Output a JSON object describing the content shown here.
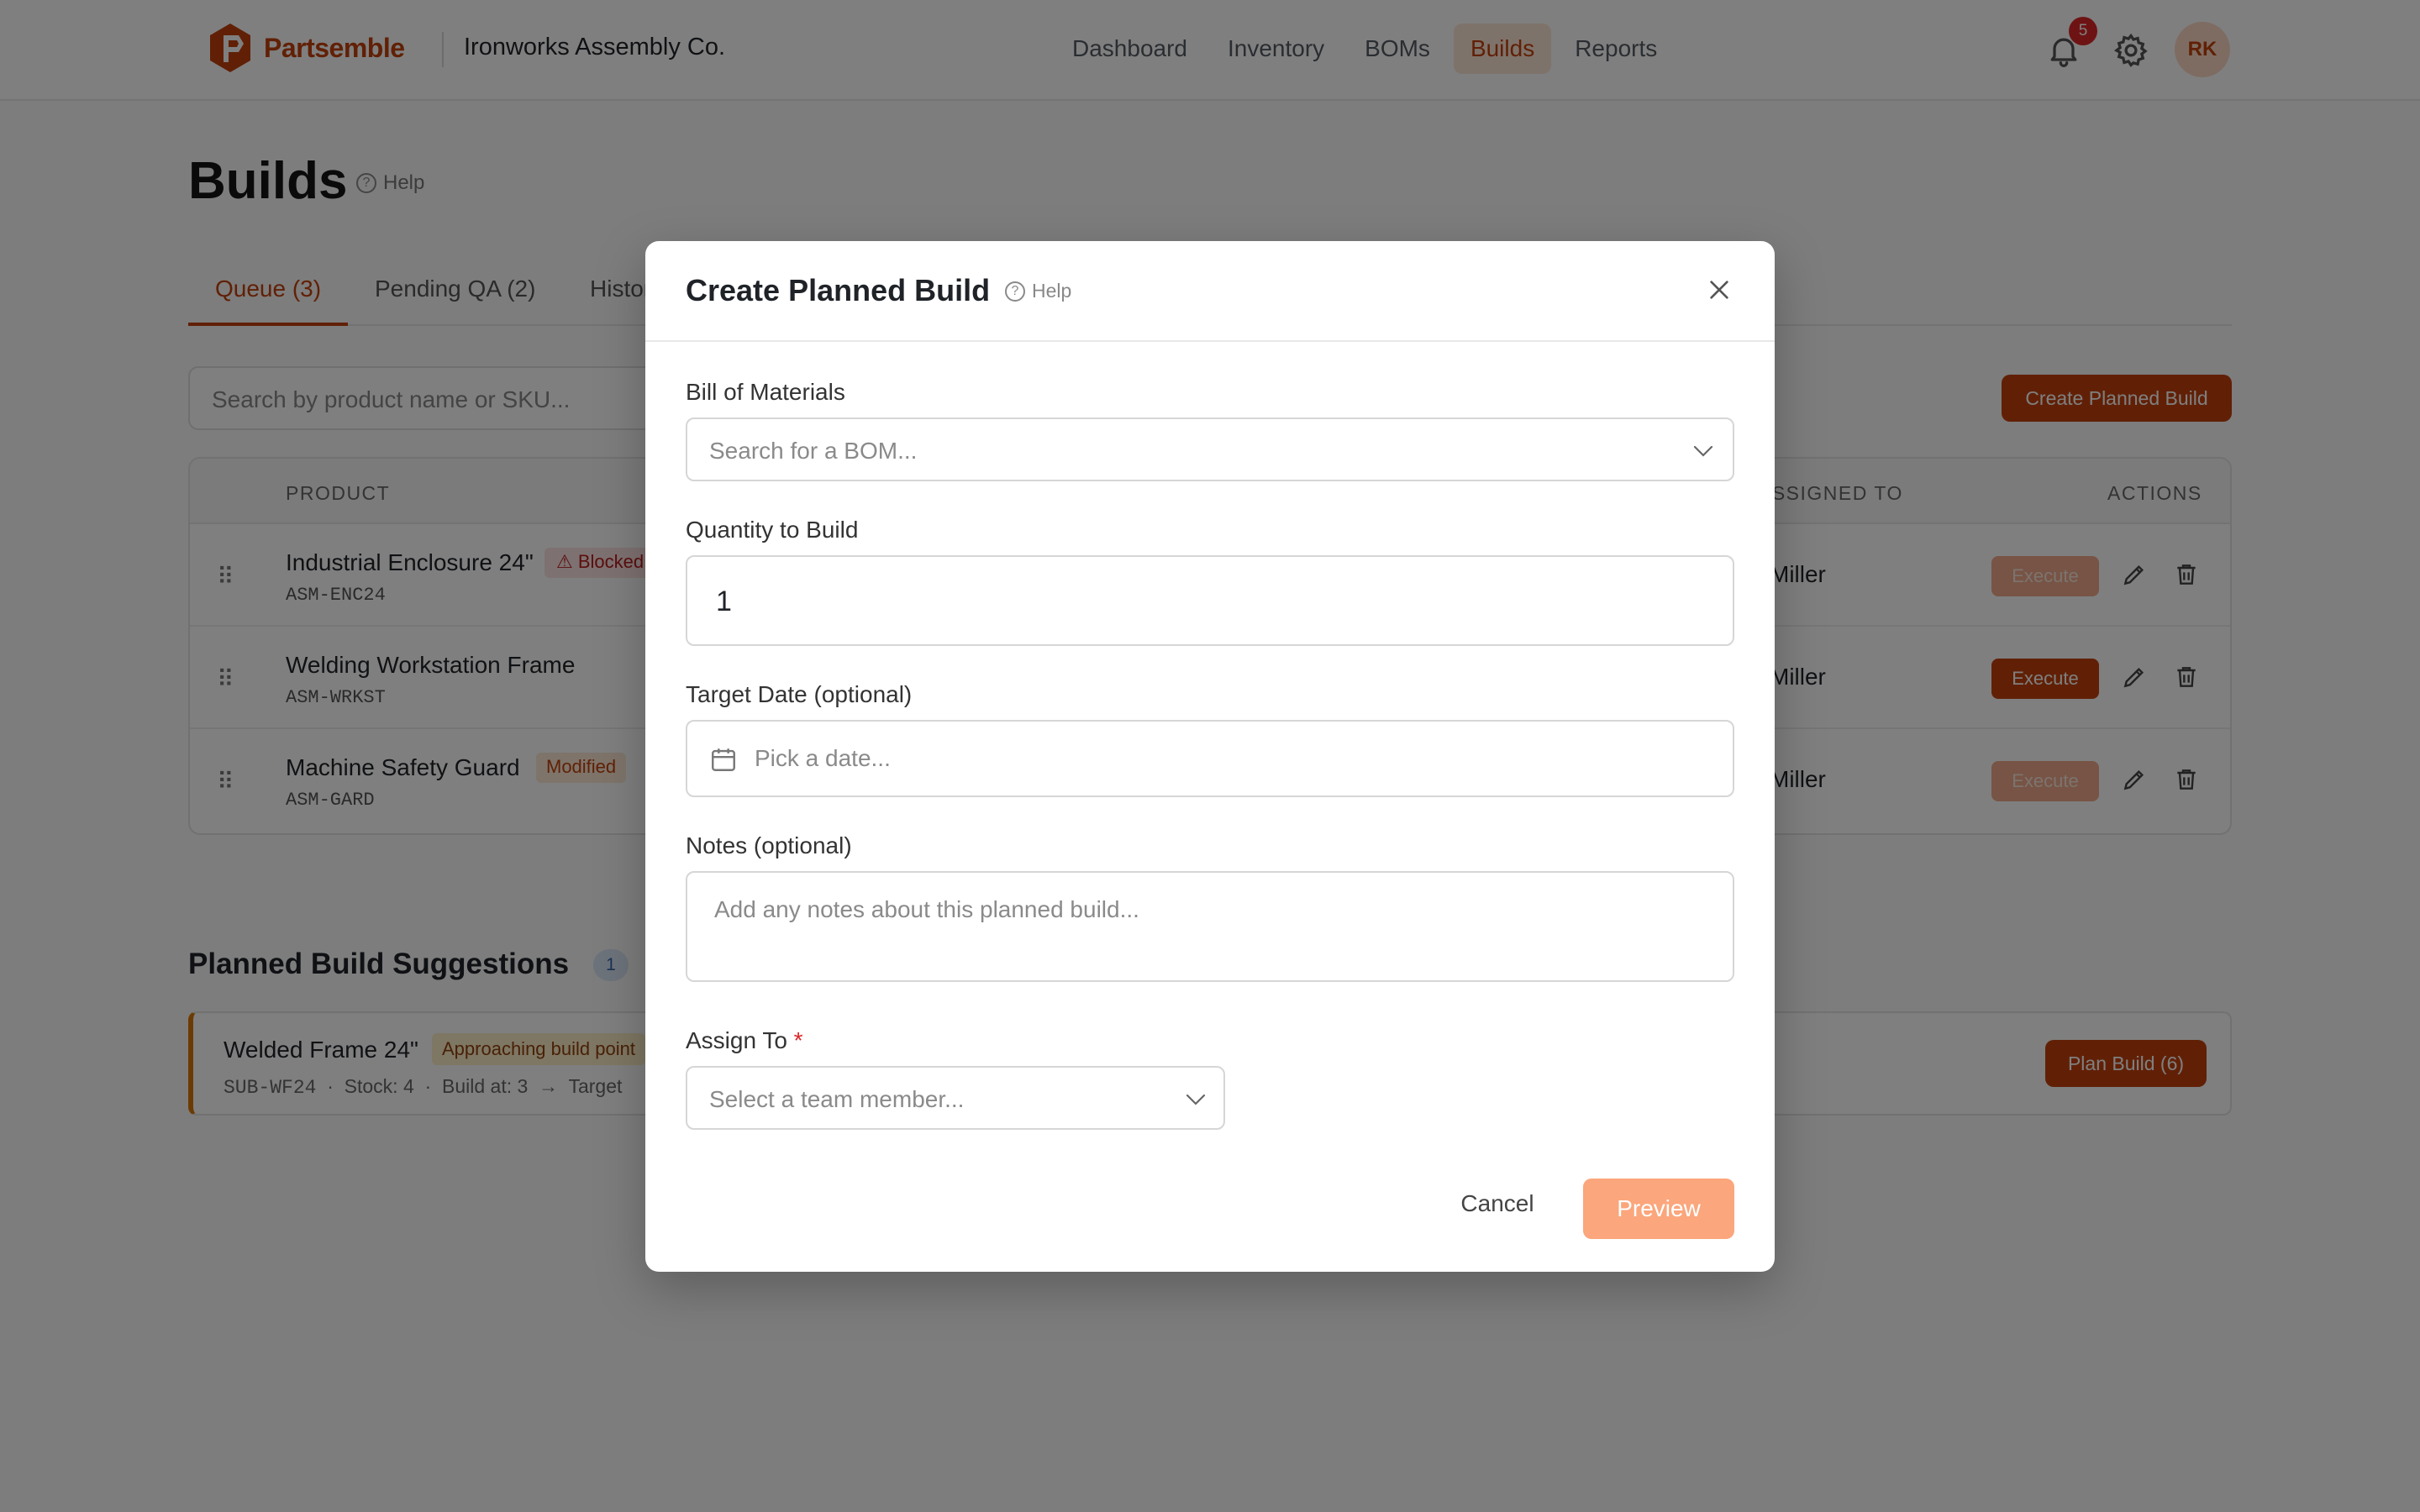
{
  "brand": {
    "name": "Partsemble",
    "company": "Ironworks Assembly Co.",
    "accent": "#c2410c"
  },
  "nav": {
    "links": [
      "Dashboard",
      "Inventory",
      "BOMs",
      "Builds",
      "Reports"
    ],
    "active": "Builds",
    "notification_count": "5",
    "avatar_initials": "RK"
  },
  "page": {
    "title": "Builds",
    "help": "Help",
    "tabs": [
      "Queue (3)",
      "Pending QA (2)",
      "History"
    ],
    "search_placeholder": "Search by product name or SKU...",
    "create_button": "Create Planned Build"
  },
  "table": {
    "headers": {
      "product": "PRODUCT",
      "assigned": "ASSIGNED TO",
      "actions": "ACTIONS"
    },
    "rows": [
      {
        "name": "Industrial Enclosure 24\"",
        "sku": "ASM-ENC24",
        "tag": "Blocked",
        "assignee": "Miller",
        "execute": "Execute"
      },
      {
        "name": "Welding Workstation Frame",
        "sku": "ASM-WRKST",
        "tag": "",
        "assignee": "Miller",
        "execute": "Execute"
      },
      {
        "name": "Machine Safety Guard",
        "sku": "ASM-GARD",
        "tag": "Modified",
        "assignee": "Miller",
        "execute": "Execute"
      }
    ]
  },
  "suggestions": {
    "title": "Planned Build Suggestions",
    "count": "1",
    "item": {
      "name": "Welded Frame 24\"",
      "tag": "Approaching build point",
      "sku": "SUB-WF24",
      "stock": "Stock: 4",
      "build_at": "Build at: 3",
      "arrow": "→",
      "target": "Target",
      "button": "Plan Build (6)"
    }
  },
  "modal": {
    "title": "Create Planned Build",
    "help": "Help",
    "bom_label": "Bill of Materials",
    "bom_placeholder": "Search for a BOM...",
    "quantity_label": "Quantity to Build",
    "quantity_value": "1",
    "date_label": "Target Date (optional)",
    "date_placeholder": "Pick a date...",
    "notes_label": "Notes (optional)",
    "notes_placeholder": "Add any notes about this planned build...",
    "assign_label": "Assign To",
    "assign_required": "*",
    "assign_placeholder": "Select a team member...",
    "cancel": "Cancel",
    "preview": "Preview"
  }
}
